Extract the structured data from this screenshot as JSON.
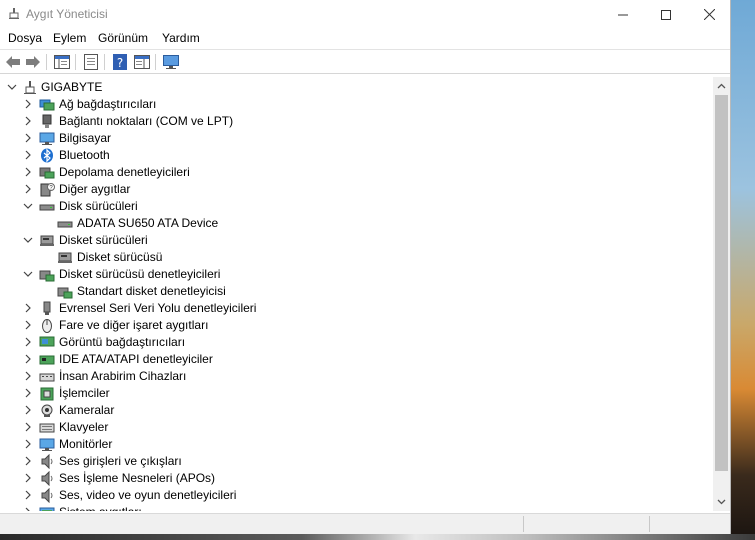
{
  "window": {
    "title": "Aygıt Yöneticisi",
    "controls": [
      "minimize",
      "maximize",
      "close"
    ]
  },
  "menu": [
    "Dosya",
    "Eylem",
    "Görünüm",
    "Yardım"
  ],
  "toolbar": {
    "icons": [
      "back-arrow-icon",
      "forward-arrow-icon",
      "show-hide-console-tree-icon",
      "properties-icon",
      "help-icon",
      "action-pane-icon",
      "monitor-icon"
    ]
  },
  "tree": {
    "root": "GIGABYTE",
    "items": [
      {
        "label": "Ağ bağdaştırıcıları",
        "level": 1,
        "expanded": false,
        "icon": "network-adapter-icon"
      },
      {
        "label": "Bağlantı noktaları (COM ve LPT)",
        "level": 1,
        "expanded": false,
        "icon": "port-icon"
      },
      {
        "label": "Bilgisayar",
        "level": 1,
        "expanded": false,
        "icon": "computer-icon"
      },
      {
        "label": "Bluetooth",
        "level": 1,
        "expanded": false,
        "icon": "bluetooth-icon"
      },
      {
        "label": "Depolama denetleyicileri",
        "level": 1,
        "expanded": false,
        "icon": "storage-controller-icon"
      },
      {
        "label": "Diğer aygıtlar",
        "level": 1,
        "expanded": false,
        "icon": "unknown-device-icon"
      },
      {
        "label": "Disk sürücüleri",
        "level": 1,
        "expanded": true,
        "icon": "disk-drive-icon"
      },
      {
        "label": "ADATA SU650 ATA Device",
        "level": 2,
        "expanded": null,
        "icon": "disk-drive-icon"
      },
      {
        "label": "Disket sürücüleri",
        "level": 1,
        "expanded": true,
        "icon": "floppy-drive-icon"
      },
      {
        "label": "Disket sürücüsü",
        "level": 2,
        "expanded": null,
        "icon": "floppy-drive-icon"
      },
      {
        "label": "Disket sürücüsü denetleyicileri",
        "level": 1,
        "expanded": true,
        "icon": "floppy-controller-icon"
      },
      {
        "label": "Standart disket denetleyicisi",
        "level": 2,
        "expanded": null,
        "icon": "floppy-controller-icon"
      },
      {
        "label": "Evrensel Seri Veri Yolu denetleyicileri",
        "level": 1,
        "expanded": false,
        "icon": "usb-icon"
      },
      {
        "label": "Fare ve diğer işaret aygıtları",
        "level": 1,
        "expanded": false,
        "icon": "mouse-icon"
      },
      {
        "label": "Görüntü bağdaştırıcıları",
        "level": 1,
        "expanded": false,
        "icon": "display-adapter-icon"
      },
      {
        "label": "IDE ATA/ATAPI denetleyiciler",
        "level": 1,
        "expanded": false,
        "icon": "ide-controller-icon"
      },
      {
        "label": "İnsan Arabirim Cihazları",
        "level": 1,
        "expanded": false,
        "icon": "hid-icon"
      },
      {
        "label": "İşlemciler",
        "level": 1,
        "expanded": false,
        "icon": "processor-icon"
      },
      {
        "label": "Kameralar",
        "level": 1,
        "expanded": false,
        "icon": "camera-icon"
      },
      {
        "label": "Klavyeler",
        "level": 1,
        "expanded": false,
        "icon": "keyboard-icon"
      },
      {
        "label": "Monitörler",
        "level": 1,
        "expanded": false,
        "icon": "monitor-icon"
      },
      {
        "label": "Ses girişleri ve çıkışları",
        "level": 1,
        "expanded": false,
        "icon": "speaker-icon"
      },
      {
        "label": "Ses İşleme Nesneleri (APOs)",
        "level": 1,
        "expanded": false,
        "icon": "speaker-icon"
      },
      {
        "label": "Ses, video ve oyun denetleyicileri",
        "level": 1,
        "expanded": false,
        "icon": "speaker-icon"
      },
      {
        "label": "Sistem aygıtları",
        "level": 1,
        "expanded": false,
        "icon": "system-device-icon"
      }
    ]
  }
}
